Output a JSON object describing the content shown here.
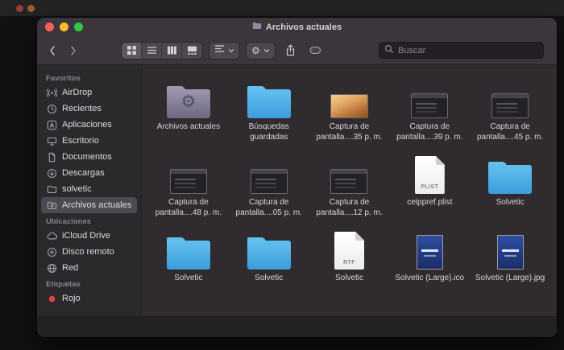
{
  "colors": {
    "folder_blue_top": "#62bfef",
    "folder_blue_bottom": "#3c9ddb",
    "smart_folder_top": "#9d96ae",
    "smart_folder_bottom": "#6e6780",
    "sidebar_selection": "#4d4950",
    "tag_red": "#e0443e",
    "traffic_red": "#f95f57",
    "traffic_yellow": "#fbbd2e",
    "traffic_green": "#2fc840"
  },
  "window": {
    "title": "Archivos actuales"
  },
  "toolbar": {
    "search_placeholder": "Buscar"
  },
  "sidebar": {
    "sections": [
      {
        "label": "Favoritos",
        "items": [
          {
            "label": "AirDrop",
            "icon": "airdrop-icon"
          },
          {
            "label": "Recientes",
            "icon": "clock-icon"
          },
          {
            "label": "Aplicaciones",
            "icon": "applications-icon"
          },
          {
            "label": "Escritorio",
            "icon": "desktop-icon"
          },
          {
            "label": "Documentos",
            "icon": "document-icon"
          },
          {
            "label": "Descargas",
            "icon": "downloads-icon"
          },
          {
            "label": "solvetic",
            "icon": "folder-icon"
          },
          {
            "label": "Archivos actuales",
            "icon": "smart-folder-icon",
            "selected": true
          }
        ]
      },
      {
        "label": "Ubicaciones",
        "items": [
          {
            "label": "iCloud Drive",
            "icon": "cloud-icon"
          },
          {
            "label": "Disco remoto",
            "icon": "disc-icon"
          },
          {
            "label": "Red",
            "icon": "globe-icon"
          }
        ]
      },
      {
        "label": "Etiquetas",
        "items": [
          {
            "label": "Rojo",
            "icon": "red-tag-icon"
          }
        ]
      }
    ]
  },
  "content": {
    "files": [
      {
        "name": "Archivos actuales",
        "type": "smart-folder"
      },
      {
        "name": "Búsquedas guardadas",
        "type": "folder"
      },
      {
        "name": "Captura de pantalla....35 p. m.",
        "type": "photo"
      },
      {
        "name": "Captura de pantalla....39 p. m.",
        "type": "screenshot"
      },
      {
        "name": "Captura de pantalla....45 p. m.",
        "type": "screenshot"
      },
      {
        "name": "Captura de pantalla....48 p. m.",
        "type": "screenshot"
      },
      {
        "name": "Captura de pantalla....05 p. m.",
        "type": "screenshot"
      },
      {
        "name": "Captura de pantalla....12 p. m.",
        "type": "screenshot"
      },
      {
        "name": "ceippref.plist",
        "type": "document",
        "badge": "PLIST"
      },
      {
        "name": "Solvetic",
        "type": "folder"
      },
      {
        "name": "Solvetic",
        "type": "folder"
      },
      {
        "name": "Solvetic",
        "type": "folder"
      },
      {
        "name": "Solvetic",
        "type": "document",
        "badge": "RTF"
      },
      {
        "name": "Solvetic (Large).ico",
        "type": "image-blue"
      },
      {
        "name": "Solvetic (Large).jpg",
        "type": "image-blue"
      }
    ]
  }
}
